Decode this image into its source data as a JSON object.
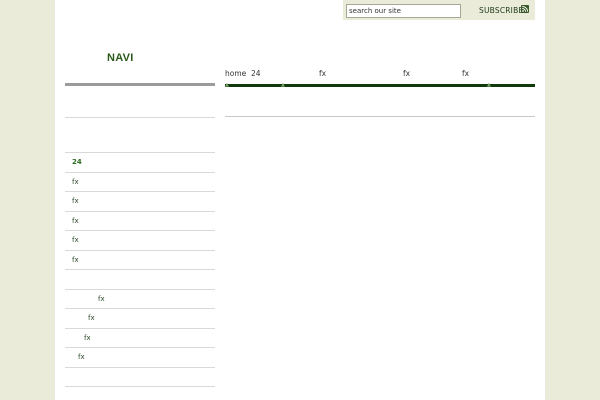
{
  "header": {
    "search_placeholder": "search our site",
    "subscribe_label": "SUBSCRIBE"
  },
  "sidebar": {
    "heading": "NAVI",
    "items": [
      {
        "label": "24",
        "active": true
      },
      {
        "label": "fx"
      },
      {
        "label": "fx"
      },
      {
        "label": "fx"
      },
      {
        "label": "fx"
      },
      {
        "label": "fx"
      },
      {
        "label": "fx"
      },
      {
        "label": "fx"
      },
      {
        "label": "fx"
      },
      {
        "label": "fx"
      }
    ]
  },
  "navigation": {
    "items": [
      {
        "label": "home"
      },
      {
        "label": "24"
      },
      {
        "label": "fx"
      },
      {
        "label": "fx"
      },
      {
        "label": "fx"
      }
    ]
  },
  "colors": {
    "background": "#ebebda",
    "accent": "#113a0c",
    "heading": "#2a5a1a"
  }
}
